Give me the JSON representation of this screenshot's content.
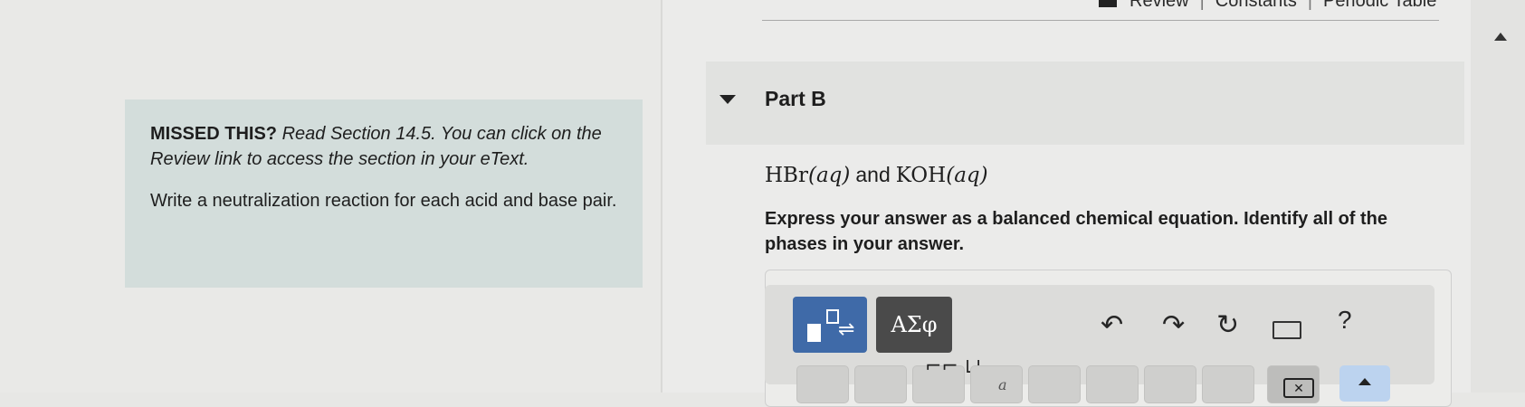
{
  "top_links": {
    "review": "Review",
    "constants": "Constants",
    "periodic_table": "Periodic Table",
    "separator": "|"
  },
  "hint": {
    "missed": "MISSED THIS?",
    "read": "Read Section 14.5. You can click on the Review link to access the section in your eText.",
    "task": "Write a neutralization reaction for each acid and base pair."
  },
  "part": {
    "title": "Part B"
  },
  "reactants": {
    "acid": "HBr",
    "acid_phase": "(aq)",
    "conj": "and",
    "base": "KOH",
    "base_phase": "(aq)"
  },
  "instructions": "Express your answer as a balanced chemical equation. Identify all of the phases in your answer.",
  "toolbar": {
    "symbols_label": "ΑΣφ",
    "undo": "↶",
    "redo": "↷",
    "reset": "↻",
    "help": "?"
  },
  "keypad": {
    "bracket_label": "⌐⌐ ⊔",
    "sub_label": "a"
  },
  "colors": {
    "accent_blue": "#3f6aa8",
    "hint_bg": "#d3dddb"
  }
}
